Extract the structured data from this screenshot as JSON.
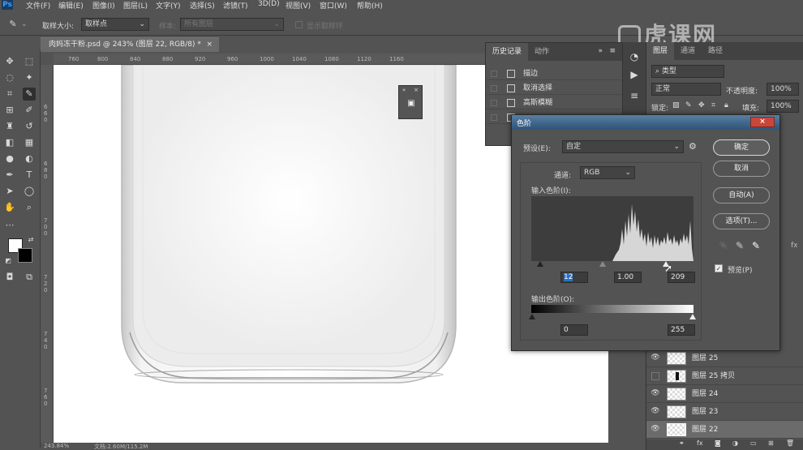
{
  "menu": [
    "文件(F)",
    "编辑(E)",
    "图像(I)",
    "图层(L)",
    "文字(Y)",
    "选择(S)",
    "滤镜(T)",
    "3D(D)",
    "视图(V)",
    "窗口(W)",
    "帮助(H)"
  ],
  "options": {
    "sample_size_label": "取样大小:",
    "sample_size_value": "取样点",
    "sample_label": "样本:",
    "sample_value": "所有图层",
    "show_ring_label": "显示取样环"
  },
  "document": {
    "tab_title": "肉妈冻干粉.psd @ 243% (图层 22, RGB/8) *",
    "tab_close": "×",
    "ruler_h": [
      "760",
      "780",
      "800",
      "820",
      "840",
      "860",
      "880",
      "900",
      "920",
      "940",
      "960",
      "980",
      "1000",
      "1020",
      "1040",
      "1060",
      "1080",
      "1100",
      "1120",
      "1140",
      "1160"
    ],
    "ruler_v": [
      "6",
      "4",
      "0",
      "6",
      "6",
      "0",
      "6",
      "8",
      "0",
      "7",
      "0",
      "0",
      "7",
      "2",
      "0",
      "7",
      "4",
      "0",
      "7",
      "6",
      "0",
      "7",
      "8",
      "0",
      "8",
      "0",
      "0"
    ],
    "status_left": "243.84%",
    "status_doc": "文档:2.60M/115.2M"
  },
  "history_panel": {
    "tabs": [
      "历史记录",
      "动作"
    ],
    "menu_icon": "≡",
    "items": [
      "描边",
      "取消选择",
      "高斯模糊",
      ""
    ]
  },
  "layers_panel": {
    "tabs": [
      "图层",
      "通道",
      "路径"
    ],
    "filter_value": "类型",
    "blend_mode": "正常",
    "opacity_label": "不透明度:",
    "opacity_value": "100%",
    "lock_label": "锁定:",
    "fill_label": "填充:",
    "fill_value": "100%",
    "rows": [
      {
        "name": "图层 25",
        "visible": true,
        "thumb": "checker"
      },
      {
        "name": "图层 25 拷贝",
        "visible": false,
        "thumb": "black"
      },
      {
        "name": "图层 24",
        "visible": true,
        "thumb": "checker"
      },
      {
        "name": "图层 23",
        "visible": true,
        "thumb": "checker"
      },
      {
        "name": "图层 22",
        "visible": true,
        "thumb": "checker",
        "selected": true
      }
    ],
    "footer_icons": [
      "link-icon",
      "fx-icon",
      "mask-icon",
      "adjustment-icon",
      "group-icon",
      "new-layer-icon",
      "trash-icon"
    ]
  },
  "levels_dialog": {
    "title": "色阶",
    "close": "×",
    "preset_label": "预设(E):",
    "preset_value": "自定",
    "channel_label": "通道:",
    "channel_value": "RGB",
    "input_label": "输入色阶(I):",
    "input_black": "12",
    "input_gamma": "1.00",
    "input_white": "209",
    "output_label": "输出色阶(O):",
    "output_black": "0",
    "output_white": "255",
    "buttons": {
      "ok": "确定",
      "cancel": "取消",
      "auto": "自动(A)",
      "options": "选项(T)..."
    },
    "preview_label": "预览(P)",
    "preview_checked": true
  },
  "watermark": "虎课网",
  "colors": {
    "ui_bg": "#535353",
    "panel_dark": "#424242",
    "title_blue": "#3d6589",
    "close_red": "#c9473a",
    "highlight_blue": "#2c6fbf"
  }
}
